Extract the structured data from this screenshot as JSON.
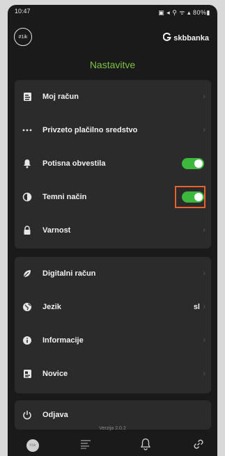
{
  "status": {
    "time": "10:47",
    "icons": "▣ ◂ ⚲ ᯤ ▴ 80%▮"
  },
  "header": {
    "user_badge": "#1ik",
    "bank_name": "skbbanka",
    "title": "Nastavitve"
  },
  "settings": [
    {
      "label": "Moj račun",
      "icon": "document-icon",
      "type": "chevron"
    },
    {
      "label": "Privzeto plačilno sredstvo",
      "icon": "more-dots-icon",
      "type": "chevron"
    },
    {
      "label": "Potisna obvestila",
      "icon": "bell-icon",
      "type": "toggle",
      "on": true
    },
    {
      "label": "Temni način",
      "icon": "contrast-icon",
      "type": "toggle",
      "on": true,
      "highlighted": true
    },
    {
      "label": "Varnost",
      "icon": "lock-icon",
      "type": "chevron"
    }
  ],
  "more_settings": [
    {
      "label": "Digitalni račun",
      "icon": "leaf-icon",
      "type": "chevron"
    },
    {
      "label": "Jezik",
      "icon": "globe-icon",
      "type": "value",
      "value": "sl"
    },
    {
      "label": "Informacije",
      "icon": "info-icon",
      "type": "chevron"
    },
    {
      "label": "Novice",
      "icon": "news-icon",
      "type": "chevron"
    }
  ],
  "logout": {
    "label": "Odjava",
    "icon": "power-icon"
  },
  "version": "Verzija 2.0.2",
  "nav": {
    "avatar_text": "#1ik",
    "items": [
      "home-avatar",
      "list-icon",
      "bell-icon",
      "link-icon"
    ]
  },
  "colors": {
    "accent": "#7dc242",
    "toggle_on": "#3cb93c",
    "highlight": "#e8622a",
    "card": "#2b2b2b",
    "background": "#1a1a1a"
  }
}
